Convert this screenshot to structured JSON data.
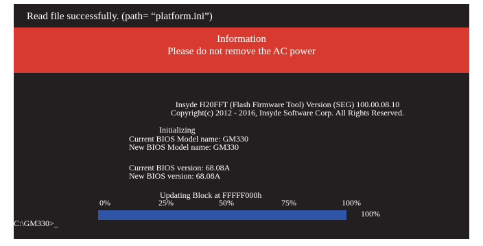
{
  "status_line": "Read file successfully.   (path= “platform.ini”)",
  "info_box": {
    "title": "Information",
    "message": "Please do not remove the AC power",
    "color": "#d93a2f"
  },
  "tool": {
    "version_line": "Insyde H20FFT (Flash Firmware Tool) Version (SEG) 100.00.08.10",
    "copyright_line": "Copyright(c) 2012 - 2016, Insyde Software Corp. All Rights Reserved."
  },
  "bios": {
    "state": "Initializing",
    "current_model": "Current BIOS Model name: GM330",
    "new_model": "New   BIOS Model name: GM330",
    "current_version": "Current BIOS version: 68.08A",
    "new_version": "New BIOS version: 68.08A"
  },
  "progress": {
    "updating_label": "Updating Block at FFFFF000h",
    "scale": [
      "0%",
      "25%",
      "50%",
      "75%",
      "100%"
    ],
    "percent_label": "100%",
    "fraction": 1.0,
    "fill_color": "#2f55a8"
  },
  "prompt": "C:\\GM330>_"
}
